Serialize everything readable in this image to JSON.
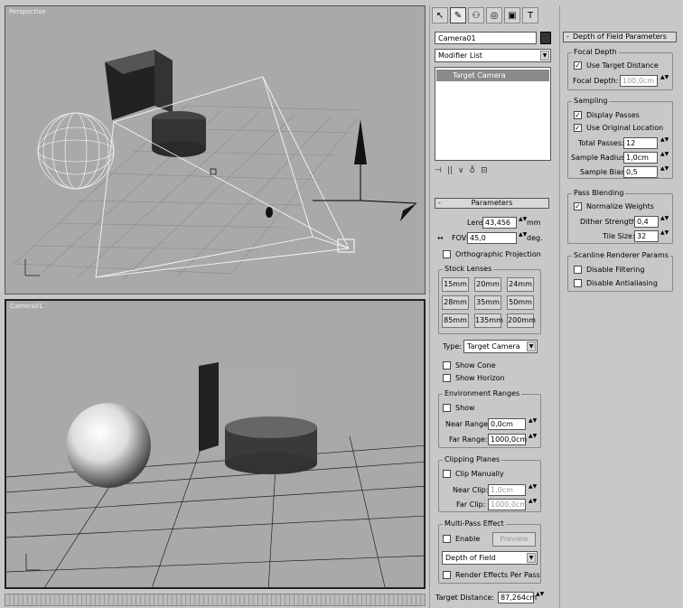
{
  "viewports": {
    "perspective_label": "Perspective",
    "camera_label": "Camera01"
  },
  "command_panel": {
    "tabs": [
      {
        "name": "create-tab-icon",
        "glyph": "↖"
      },
      {
        "name": "modify-tab-icon",
        "glyph": "✎"
      },
      {
        "name": "hierarchy-tab-icon",
        "glyph": "⚇"
      },
      {
        "name": "motion-tab-icon",
        "glyph": "◎"
      },
      {
        "name": "display-tab-icon",
        "glyph": "▣"
      },
      {
        "name": "utilities-tab-icon",
        "glyph": "T"
      }
    ],
    "object_name": "Camera01",
    "color_swatch": "#333333",
    "modifier_list": "Modifier List",
    "stack_item": "Target Camera",
    "stack_icons": [
      "⊣",
      "||",
      "∨",
      "♁",
      "⊟"
    ]
  },
  "parameters": {
    "header": "Parameters",
    "collapse_glyph": "-",
    "lens_label": "Lens:",
    "lens_value": "43,456",
    "lens_unit": "mm",
    "fov_label": "FOV:",
    "fov_value": "45,0",
    "fov_unit": "deg.",
    "ortho_label": "Orthographic Projection",
    "stock_lenses_title": "Stock Lenses",
    "stock_lenses": [
      "15mm",
      "20mm",
      "24mm",
      "28mm",
      "35mm",
      "50mm",
      "85mm",
      "135mm",
      "200mm"
    ],
    "type_label": "Type:",
    "type_value": "Target Camera",
    "show_cone": "Show Cone",
    "show_horizon": "Show Horizon",
    "env_ranges_title": "Environment Ranges",
    "env_show": "Show",
    "near_range_label": "Near Range:",
    "near_range_value": "0,0cm",
    "far_range_label": "Far Range:",
    "far_range_value": "1000,0cm",
    "clipping_title": "Clipping Planes",
    "clip_manually": "Clip Manually",
    "near_clip_label": "Near Clip:",
    "near_clip_value": "1,0cm",
    "far_clip_label": "Far Clip:",
    "far_clip_value": "1000,0cm",
    "multipass_title": "Multi-Pass Effect",
    "enable_label": "Enable",
    "preview_label": "Preview",
    "effect_value": "Depth of Field",
    "render_effects": "Render Effects Per Pass",
    "target_distance_label": "Target Distance:",
    "target_distance_value": "87,264cm"
  },
  "dof": {
    "header": "Depth of Field Parameters",
    "collapse_glyph": "-",
    "focal_depth_title": "Focal Depth",
    "use_target_distance": "Use Target Distance",
    "focal_depth_label": "Focal Depth:",
    "focal_depth_value": "100,0cm",
    "sampling_title": "Sampling",
    "display_passes": "Display Passes",
    "use_original_location": "Use Original Location",
    "total_passes_label": "Total Passes:",
    "total_passes_value": "12",
    "sample_radius_label": "Sample Radius:",
    "sample_radius_value": "1,0cm",
    "sample_bias_label": "Sample Bias:",
    "sample_bias_value": "0,5",
    "pass_blending_title": "Pass Blending",
    "normalize_weights": "Normalize Weights",
    "dither_label": "Dither Strength:",
    "dither_value": "0,4",
    "tile_label": "Tile Size:",
    "tile_value": "32",
    "scanline_title": "Scanline Renderer Params",
    "disable_filtering": "Disable Filtering",
    "disable_antialiasing": "Disable Antialiasing"
  },
  "check_glyph": "✓",
  "spinner_glyph": "▲▼",
  "dropdown_glyph": "▼"
}
